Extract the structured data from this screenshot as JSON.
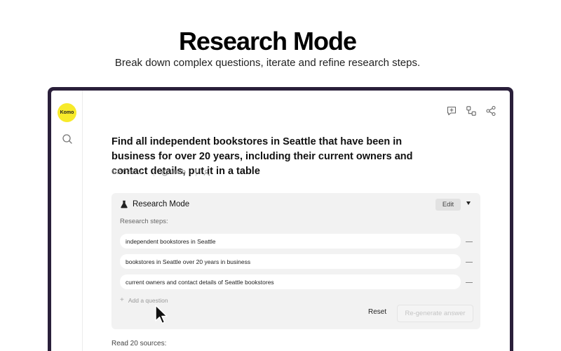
{
  "hero": {
    "title": "Research Mode",
    "subtitle": "Break down complex questions, iterate and refine research steps."
  },
  "sidebar": {
    "logo_text": "Komo",
    "logo_color": "#f7ea2a",
    "search_icon": "search-icon"
  },
  "toolbar": {
    "icons": [
      "new-chat-icon",
      "nodes-icon",
      "share-icon"
    ]
  },
  "question": "Find all independent bookstores in Seattle that have been in business for over 20 years, including their current owners and contact details, put it in a table",
  "meta": {
    "model": "GPT-4o",
    "source": "Web",
    "person_icon": "person-icon"
  },
  "research": {
    "title": "Research Mode",
    "edit_label": "Edit",
    "steps_label": "Research steps:",
    "steps": [
      "independent bookstores in Seattle",
      "bookstores in Seattle over 20 years in business",
      "current owners and contact details of Seattle bookstores"
    ],
    "add_question_label": "Add a question",
    "reset_label": "Reset",
    "regenerate_label": "Re-generate answer"
  },
  "sources_label": "Read 20 sources:",
  "colors": {
    "frame": "#2a1f3a",
    "panel_bg": "#f2f2f2",
    "accent_logo": "#f7ea2a"
  }
}
